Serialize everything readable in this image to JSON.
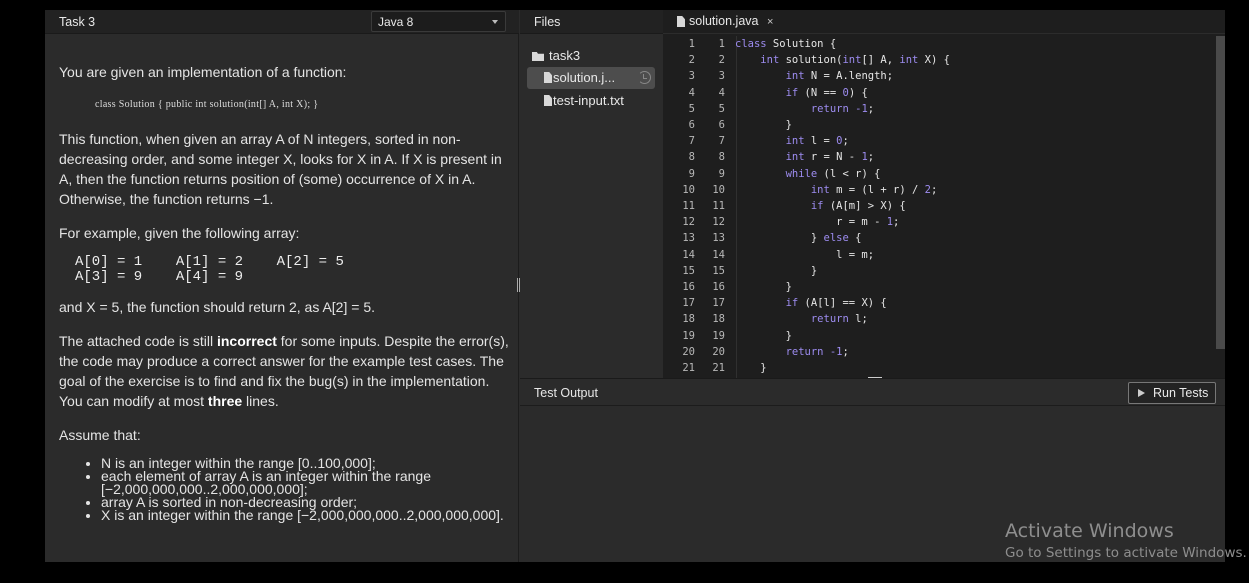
{
  "task_panel": {
    "title": "Task 3",
    "language": "Java 8",
    "intro": "You are given an implementation of a function:",
    "signature": "class Solution { public int solution(int[] A, int X); }",
    "description": "This function, when given an array A of N integers, sorted in non-decreasing order, and some integer X, looks for X in A. If X is present in A, then the function returns position of (some) occurrence of X in A. Otherwise, the function returns −1.",
    "example_intro": "For example, given the following array:",
    "array_line1": "A[0] = 1    A[1] = 2    A[2] = 5",
    "array_line2": "A[3] = 9    A[4] = 9",
    "example_result": "and X = 5, the function should return 2, as A[2] = 5.",
    "incorrect_pre": "The attached code is still ",
    "incorrect_bold": "incorrect",
    "incorrect_mid": " for some inputs. Despite the error(s), the code may produce a correct answer for the example test cases. The goal of the exercise is to find and fix the bug(s) in the implementation. You can modify at most ",
    "incorrect_bold2": "three",
    "incorrect_post": " lines.",
    "assume_heading": "Assume that:",
    "assumptions": [
      "N is an integer within the range [0..100,000];",
      "each element of array A is an integer within the range [−2,000,000,000..2,000,000,000];",
      "array A is sorted in non-decreasing order;",
      "X is an integer within the range [−2,000,000,000..2,000,000,000]."
    ]
  },
  "files_panel": {
    "title": "Files",
    "folder": "task3",
    "files": [
      "solution.j...",
      "test-input.txt"
    ]
  },
  "editor": {
    "tab_label": "solution.java",
    "tab_close": "×",
    "line_numbers": [
      "1",
      "2",
      "3",
      "4",
      "5",
      "6",
      "7",
      "8",
      "9",
      "10",
      "11",
      "12",
      "13",
      "14",
      "15",
      "16",
      "17",
      "18",
      "19",
      "20",
      "21"
    ]
  },
  "output": {
    "title": "Test Output",
    "run_button": "Run Tests"
  },
  "watermark": {
    "title": "Activate Windows",
    "subtitle": "Go to Settings to activate Windows."
  }
}
